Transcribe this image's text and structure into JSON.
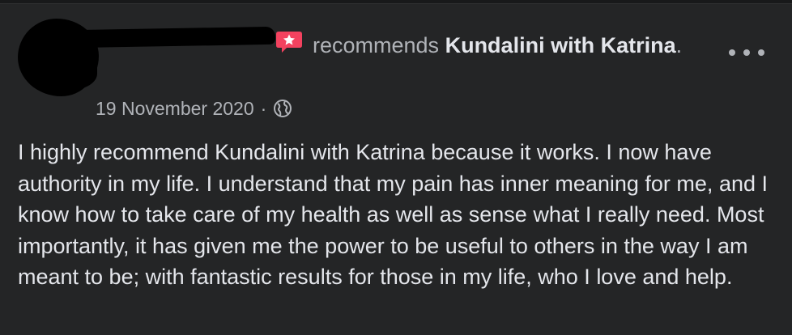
{
  "post": {
    "recommends_label": "recommends",
    "page_name_line1": "Kundalini with",
    "page_name_line2": "Katrina",
    "period": ".",
    "date": "19 November 2020",
    "separator": "·",
    "audience_icon": "globe-icon",
    "recommendation_icon": "recommendation-star-icon",
    "more_icon": "more-options-icon",
    "body": "I highly recommend Kundalini with Katrina because it works. I now have authority in my life. I understand that my pain has inner meaning for me, and I know how to take care of my health as well as sense what I really need. Most importantly, it has given me the power to be useful to others in the way I am meant to be; with fantastic results for those in my life, who I love and help."
  },
  "colors": {
    "background": "#242526",
    "primary_text": "#e4e6eb",
    "secondary_text": "#b0b3b8",
    "recommend_accent": "#f3425f"
  }
}
